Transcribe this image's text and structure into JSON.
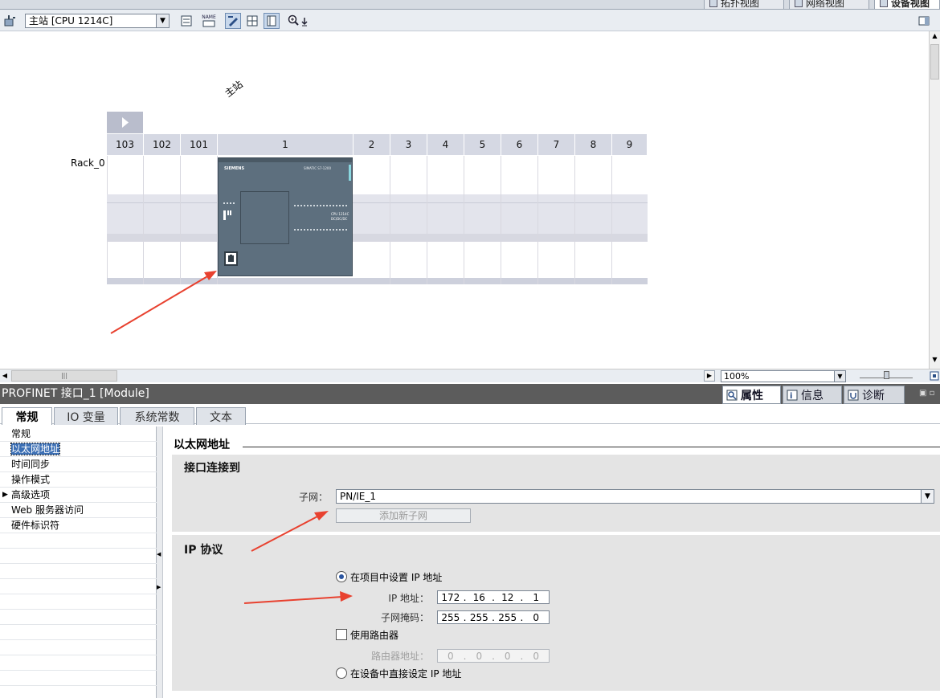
{
  "view_tabs": [
    {
      "label": "拓扑视图"
    },
    {
      "label": "网络视图"
    },
    {
      "label": "设备视图"
    }
  ],
  "toolbar": {
    "device_selector": "主站 [CPU 1214C]",
    "name_icon_text": "NAME"
  },
  "canvas": {
    "station_label": "主站",
    "rack_label": "Rack_0",
    "slots": [
      "103",
      "102",
      "101",
      "1",
      "2",
      "3",
      "4",
      "5",
      "6",
      "7",
      "8",
      "9"
    ],
    "cpu": {
      "brand": "SIEMENS",
      "series": "SIMATIC S7-1200",
      "model_line1": "CPU 1214C",
      "model_line2": "DC/DC/DC"
    }
  },
  "hbar": {
    "zoom": "100%"
  },
  "properties": {
    "title": "PROFINET 接口_1 [Module]",
    "panel_tabs": [
      {
        "label": "属性"
      },
      {
        "label": "信息"
      },
      {
        "label": "诊断"
      }
    ],
    "tabs": [
      "常规",
      "IO 变量",
      "系统常数",
      "文本"
    ],
    "nav": [
      "常规",
      "以太网地址",
      "时间同步",
      "操作模式",
      "高级选项",
      "Web 服务器访问",
      "硬件标识符"
    ],
    "section_title": "以太网地址",
    "interface": {
      "title": "接口连接到",
      "subnet_label": "子网：",
      "subnet_value": "PN/IE_1",
      "add_subnet_button": "添加新子网"
    },
    "ip": {
      "title": "IP 协议",
      "radio_project": "在项目中设置 IP 地址",
      "ip_label": "IP 地址：",
      "ip_octets": [
        "172",
        "16",
        "12",
        "1"
      ],
      "mask_label": "子网掩码：",
      "mask_octets": [
        "255",
        "255",
        "255",
        "0"
      ],
      "use_router": "使用路由器",
      "router_label": "路由器地址：",
      "router_octets": [
        "0",
        "0",
        "0",
        "0"
      ],
      "radio_device": "在设备中直接设定 IP 地址"
    }
  },
  "colors": {
    "arrow": "#e8412f",
    "title_bar": "#5c5c5c",
    "cpu_body": "#5d6f7e",
    "selection": "#3c6fb4"
  }
}
